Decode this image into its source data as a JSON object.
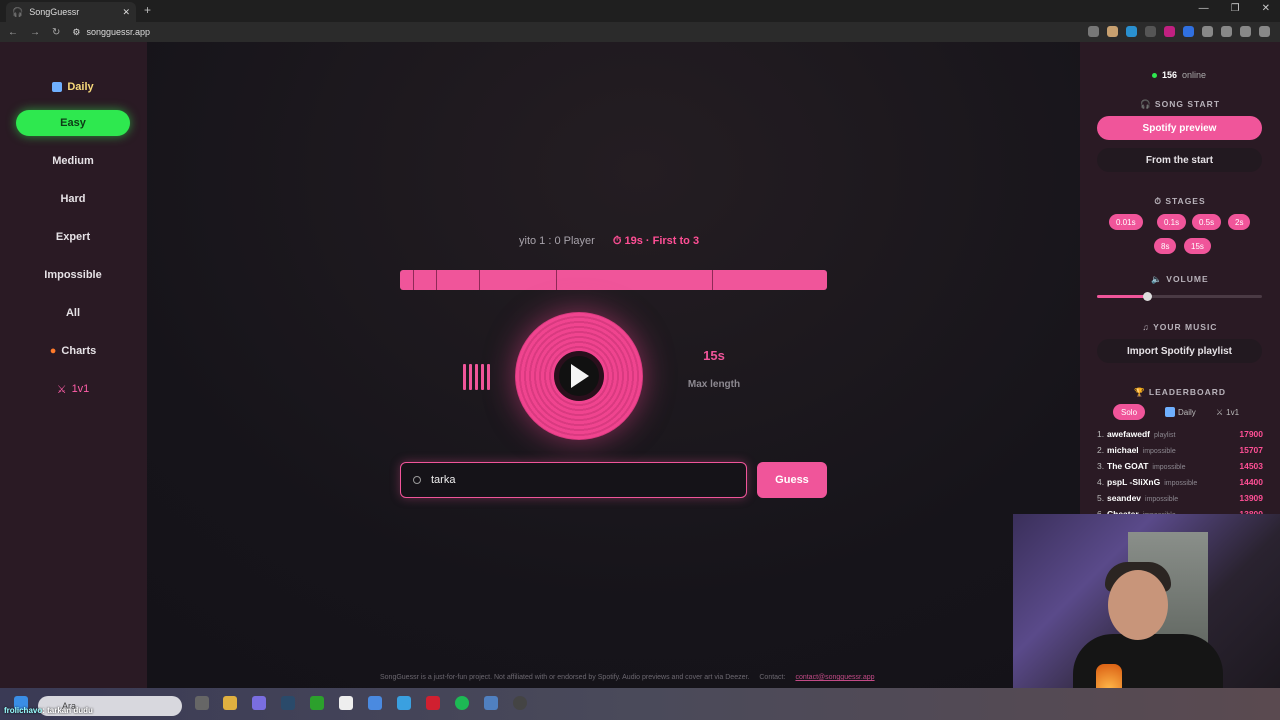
{
  "browser": {
    "tab_title": "SongGuessr",
    "url": "songguessr.app"
  },
  "leftnav": {
    "items": [
      {
        "label": "Daily"
      },
      {
        "label": "Easy"
      },
      {
        "label": "Medium"
      },
      {
        "label": "Hard"
      },
      {
        "label": "Expert"
      },
      {
        "label": "Impossible"
      },
      {
        "label": "All"
      },
      {
        "label": "Charts"
      },
      {
        "label": "1v1"
      }
    ]
  },
  "game": {
    "score": "yito 1 : 0 Player",
    "timer": "19s · First to 3",
    "max_length_value": "15s",
    "max_length_label": "Max length",
    "search_value": "tarka",
    "guess_label": "Guess",
    "progress_segments": [
      0.03,
      0.085,
      0.185,
      0.365,
      0.73
    ]
  },
  "footer": {
    "text": "SongGuessr is a just-for-fun project. Not affiliated with or endorsed by Spotify. Audio previews and cover art via Deezer.",
    "contact_label": "Contact:",
    "contact_email": "contact@songguessr.app"
  },
  "sidebar": {
    "online_count": "156",
    "online_label": "online",
    "song_start_heading": "SONG START",
    "spotify_preview": "Spotify preview",
    "from_start": "From the start",
    "stages_heading": "STAGES",
    "stages": [
      "0.01s",
      "0.1s",
      "0.5s",
      "2s",
      "8s",
      "15s"
    ],
    "volume_heading": "VOLUME",
    "volume_level": 0.3,
    "your_music_heading": "YOUR MUSIC",
    "import_label": "Import Spotify playlist",
    "leaderboard_heading": "LEADERBOARD",
    "leaderboard_tabs": [
      "Solo",
      "Daily",
      "1v1"
    ],
    "leaderboard": [
      {
        "rank": "1.",
        "name": "awefawedf",
        "mode": "playlist",
        "score": "17900"
      },
      {
        "rank": "2.",
        "name": "michael",
        "mode": "impossible",
        "score": "15707"
      },
      {
        "rank": "3.",
        "name": "The GOAT",
        "mode": "impossible",
        "score": "14503"
      },
      {
        "rank": "4.",
        "name": "pspL -SliXnG",
        "mode": "impossible",
        "score": "14400"
      },
      {
        "rank": "5.",
        "name": "seandev",
        "mode": "impossible",
        "score": "13909"
      },
      {
        "rank": "6.",
        "name": "Cheater",
        "mode": "impossible",
        "score": "13800"
      }
    ]
  },
  "taskbar": {
    "search_placeholder": "Ara"
  },
  "chat": {
    "user": "frolichavo",
    "message": ": tarkan dudu"
  },
  "colors": {
    "accent": "#f0559a",
    "active_green": "#2ee84f",
    "panel_bg": "#2a1a24"
  }
}
